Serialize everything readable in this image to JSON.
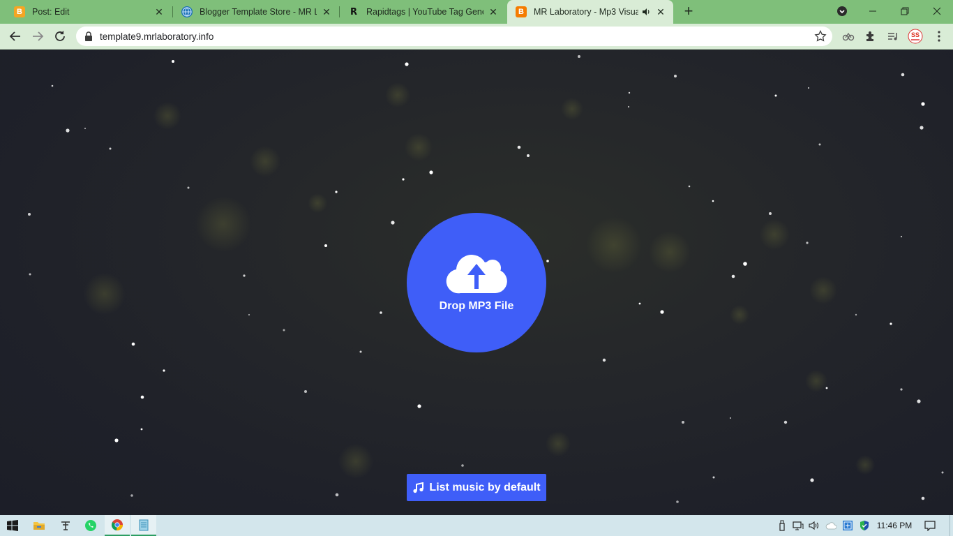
{
  "tabs": [
    {
      "title": "Post: Edit",
      "favicon": "blogger-icon",
      "favicon_color": "#f5a623",
      "active": false
    },
    {
      "title": "Blogger Template Store - MR Lab",
      "favicon": "globe-icon",
      "favicon_color": "#1a6fb5",
      "active": false
    },
    {
      "title": "Rapidtags | YouTube Tag Generat",
      "favicon": "letter-r-icon",
      "favicon_letter": "R",
      "active": false
    },
    {
      "title": "MR Laboratory - Mp3 Visual",
      "favicon": "blogger-icon",
      "favicon_color": "#f57c00",
      "active": true,
      "audio": true
    }
  ],
  "address_bar": {
    "url": "template9.mrlaboratory.info"
  },
  "main": {
    "upload_label": "Drop MP3 File",
    "list_button_label": "List music by default",
    "accent_color": "#3f5ef8"
  },
  "taskbar": {
    "time": "11:46 PM"
  }
}
